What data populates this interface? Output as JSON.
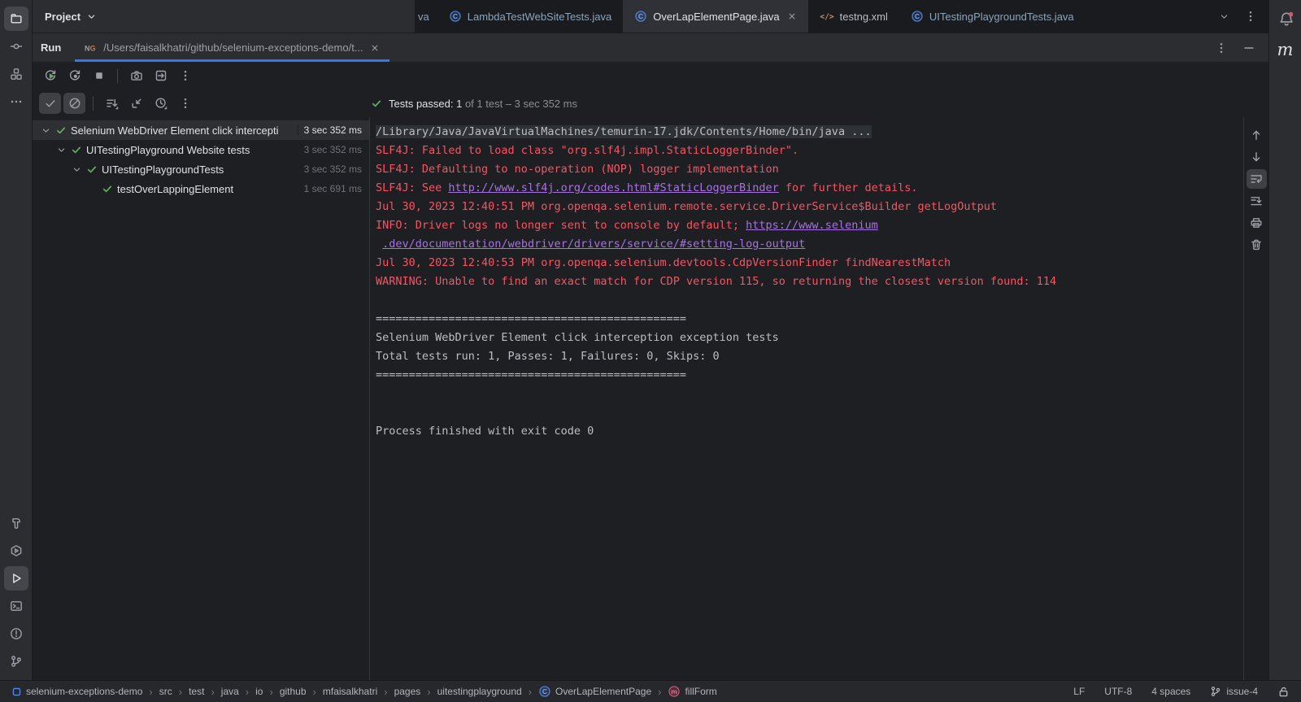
{
  "theme": {
    "accent_blue": "#3574f0",
    "success_green": "#5fad65",
    "stderr_red": "#f75464",
    "link_purple": "#a871e3",
    "panel_bg": "#2b2d30",
    "editor_bg": "#1e1f22",
    "notification_red": "#eb4f66"
  },
  "project_header": {
    "title": "Project"
  },
  "editor_tabs": {
    "partial_label": "va",
    "tabs": [
      {
        "label": "LambdaTestWebSiteTests.java",
        "icon": "class",
        "active": false,
        "closable": false,
        "modified": true
      },
      {
        "label": "OverLapElementPage.java",
        "icon": "class",
        "active": true,
        "closable": true,
        "modified": false
      },
      {
        "label": "testng.xml",
        "icon": "xml",
        "active": false,
        "closable": false,
        "modified": false
      },
      {
        "label": "UITestingPlaygroundTests.java",
        "icon": "class",
        "active": false,
        "closable": false,
        "modified": true
      }
    ]
  },
  "run_panel": {
    "tool_window_label": "Run",
    "config_tab": {
      "icon": "testng",
      "path": "/Users/faisalkhatri/github/selenium-exceptions-demo/t...",
      "closable": true
    },
    "status": {
      "passed_text": "Tests passed: 1",
      "detail_text": "of 1 test – 3 sec 352 ms"
    }
  },
  "toolbars": {
    "run": [
      {
        "icon": "rerun",
        "name": "rerun-tests-button"
      },
      {
        "icon": "rerun-failed",
        "name": "rerun-failed-tests-button"
      },
      {
        "icon": "stop",
        "name": "stop-button"
      },
      {
        "icon": "divider"
      },
      {
        "icon": "camera",
        "name": "test-snapshot-button"
      },
      {
        "icon": "export",
        "name": "export-test-results-button"
      },
      {
        "icon": "kebab",
        "name": "more-options-button"
      }
    ],
    "test": [
      {
        "icon": "check",
        "name": "show-passed-toggle",
        "toggled": true
      },
      {
        "icon": "slash",
        "name": "show-ignored-toggle",
        "toggled": true
      },
      {
        "icon": "divider"
      },
      {
        "icon": "sort",
        "name": "sort-tests-button"
      },
      {
        "icon": "import",
        "name": "import-test-results-button"
      },
      {
        "icon": "clock",
        "name": "test-history-button"
      },
      {
        "icon": "kebab",
        "name": "tree-options-button"
      }
    ],
    "console_side": [
      {
        "icon": "arrow-up",
        "name": "prev-occurrence-button"
      },
      {
        "icon": "arrow-down",
        "name": "next-occurrence-button"
      },
      {
        "icon": "soft-wrap",
        "name": "soft-wrap-toggle",
        "toggled": true
      },
      {
        "icon": "scroll-end",
        "name": "scroll-to-end-button"
      },
      {
        "icon": "print",
        "name": "print-console-button"
      },
      {
        "icon": "trash",
        "name": "clear-console-button"
      }
    ],
    "tabstrip_controls": [
      {
        "icon": "chevron-down",
        "name": "tab-list-button"
      },
      {
        "icon": "kebab",
        "name": "editor-options-button"
      }
    ],
    "run_header_controls": [
      {
        "icon": "kebab",
        "name": "tool-window-options-button"
      },
      {
        "icon": "minimize",
        "name": "hide-tool-window-button"
      }
    ]
  },
  "left_stripe": {
    "top": [
      {
        "icon": "folder",
        "name": "project-tool-button",
        "selected": true
      },
      {
        "icon": "commit",
        "name": "commit-tool-button"
      },
      {
        "icon": "structure",
        "name": "structure-tool-button"
      },
      {
        "icon": "more",
        "name": "more-tool-windows-button"
      }
    ],
    "bottom": [
      {
        "icon": "hammer",
        "name": "build-tool-button"
      },
      {
        "icon": "services",
        "name": "services-tool-button"
      },
      {
        "icon": "play",
        "name": "run-tool-button",
        "selected": true
      },
      {
        "icon": "terminal",
        "name": "terminal-tool-button"
      },
      {
        "icon": "problems",
        "name": "problems-tool-button"
      },
      {
        "icon": "git-branch",
        "name": "version-control-tool-button"
      }
    ]
  },
  "right_stripe": {
    "maven_label": "m"
  },
  "test_tree": {
    "rows": [
      {
        "label": "Selenium WebDriver Element click intercepti",
        "duration": "3 sec 352 ms",
        "level": 0,
        "chevron": true,
        "selected": true,
        "duration_bright": true
      },
      {
        "label": "UITestingPlayground Website tests",
        "duration": "3 sec 352 ms",
        "level": 1,
        "chevron": true,
        "selected": false,
        "duration_bright": false
      },
      {
        "label": "UITestingPlaygroundTests",
        "duration": "3 sec 352 ms",
        "level": 2,
        "chevron": true,
        "selected": false,
        "duration_bright": false
      },
      {
        "label": "testOverLappingElement",
        "duration": "1 sec 691 ms",
        "level": 3,
        "chevron": false,
        "selected": false,
        "duration_bright": false
      }
    ]
  },
  "console": {
    "lines": [
      {
        "segments": [
          {
            "t": "/Library/Java/JavaVirtualMachines/temurin-17.jdk/Contents/Home/bin/java ...",
            "s": "stdout"
          }
        ],
        "hl": true
      },
      {
        "segments": [
          {
            "t": "SLF4J: Failed to load class \"org.slf4j.impl.StaticLoggerBinder\".",
            "s": "stderr"
          }
        ]
      },
      {
        "segments": [
          {
            "t": "SLF4J: Defaulting to no-operation (NOP) logger implementation",
            "s": "stderr"
          }
        ]
      },
      {
        "segments": [
          {
            "t": "SLF4J: See ",
            "s": "stderr"
          },
          {
            "t": "http://www.slf4j.org/codes.html#StaticLoggerBinder",
            "s": "link"
          },
          {
            "t": " for further details.",
            "s": "stderr"
          }
        ]
      },
      {
        "segments": [
          {
            "t": "Jul 30, 2023 12:40:51 PM org.openqa.selenium.remote.service.DriverService$Builder getLogOutput",
            "s": "stderr"
          }
        ]
      },
      {
        "segments": [
          {
            "t": "INFO: Driver logs no longer sent to console by default; ",
            "s": "stderr"
          },
          {
            "t": "https://www.selenium",
            "s": "link"
          }
        ]
      },
      {
        "segments": [
          {
            "t": " ",
            "s": "stderr"
          },
          {
            "t": ".dev/documentation/webdriver/drivers/service/#setting-log-output",
            "s": "link"
          }
        ]
      },
      {
        "segments": [
          {
            "t": "Jul 30, 2023 12:40:53 PM org.openqa.selenium.devtools.CdpVersionFinder findNearestMatch",
            "s": "stderr"
          }
        ]
      },
      {
        "segments": [
          {
            "t": "WARNING: Unable to find an exact match for CDP version 115, so returning the closest version found: 114",
            "s": "stderr"
          }
        ]
      },
      {
        "segments": []
      },
      {
        "segments": [
          {
            "t": "===============================================",
            "s": "stdout"
          }
        ]
      },
      {
        "segments": [
          {
            "t": "Selenium WebDriver Element click interception exception tests",
            "s": "stdout"
          }
        ]
      },
      {
        "segments": [
          {
            "t": "Total tests run: 1, Passes: 1, Failures: 0, Skips: 0",
            "s": "stdout"
          }
        ]
      },
      {
        "segments": [
          {
            "t": "===============================================",
            "s": "stdout"
          }
        ]
      },
      {
        "segments": []
      },
      {
        "segments": []
      },
      {
        "segments": [
          {
            "t": "Process finished with exit code 0",
            "s": "stdout"
          }
        ]
      }
    ]
  },
  "status_bar": {
    "breadcrumbs": [
      {
        "label": "selenium-exceptions-demo",
        "icon": "project"
      },
      {
        "label": "src"
      },
      {
        "label": "test"
      },
      {
        "label": "java"
      },
      {
        "label": "io"
      },
      {
        "label": "github"
      },
      {
        "label": "mfaisalkhatri"
      },
      {
        "label": "pages"
      },
      {
        "label": "uitestingplayground"
      },
      {
        "label": "OverLapElementPage",
        "icon": "class"
      },
      {
        "label": "fillForm",
        "icon": "method"
      }
    ],
    "right_items": [
      {
        "label": "LF",
        "name": "line-separator-widget"
      },
      {
        "label": "UTF-8",
        "name": "encoding-widget"
      },
      {
        "label": "4 spaces",
        "name": "indent-widget"
      },
      {
        "label": "issue-4",
        "icon": "branch",
        "name": "git-branch-widget"
      },
      {
        "label": "",
        "icon": "unlock",
        "name": "readonly-toggle"
      }
    ]
  }
}
